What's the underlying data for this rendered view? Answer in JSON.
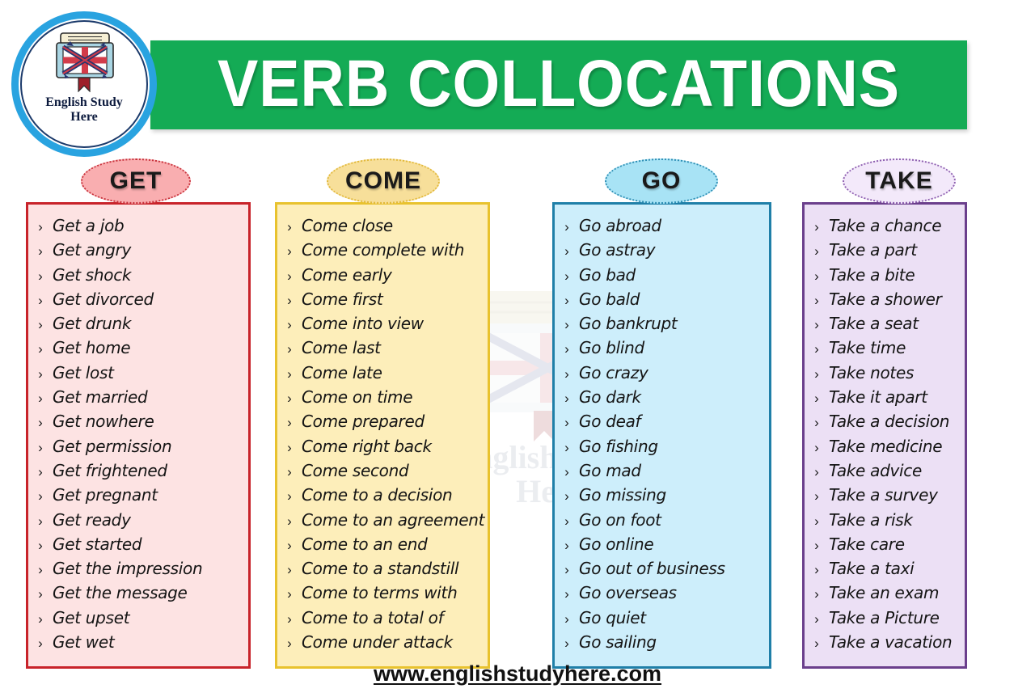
{
  "logo": {
    "name_line1": "English Study",
    "name_line2": "Here",
    "ring_color": "#29a3e0",
    "icon": "book-uk-flag-icon"
  },
  "header": {
    "title": "VERB COLLOCATIONS",
    "banner_color": "#14ab55",
    "title_color": "#ffffff"
  },
  "watermark": {
    "line1": "English Study",
    "line2": "Here"
  },
  "columns": [
    {
      "id": "get",
      "heading": "GET",
      "pill_fill": "#f9aeb0",
      "pill_border": "#c8323c",
      "box_fill": "#fde3e3",
      "box_border": "#c8232a",
      "items": [
        "Get a job",
        "Get angry",
        "Get shock",
        "Get divorced",
        "Get drunk",
        "Get home",
        "Get lost",
        "Get married",
        "Get nowhere",
        "Get permission",
        "Get frightened",
        "Get pregnant",
        "Get ready",
        "Get started",
        "Get the impression",
        "Get the message",
        "Get upset",
        "Get wet"
      ]
    },
    {
      "id": "come",
      "heading": "COME",
      "pill_fill": "#f7df9a",
      "pill_border": "#e2b93c",
      "box_fill": "#fdeeba",
      "box_border": "#e8c22e",
      "items": [
        "Come close",
        "Come complete with",
        "Come early",
        "Come first",
        "Come into view",
        "Come last",
        "Come late",
        "Come on time",
        "Come prepared",
        "Come right back",
        "Come second",
        "Come to a decision",
        "Come to an agreement",
        "Come to an end",
        "Come to a standstill",
        "Come to terms with",
        "Come to a total of",
        "Come under attack"
      ]
    },
    {
      "id": "go",
      "heading": "GO",
      "pill_fill": "#a8e3f5",
      "pill_border": "#2f8fb5",
      "box_fill": "#cdeefb",
      "box_border": "#1f7fa8",
      "items": [
        "Go abroad",
        "Go astray",
        "Go bad",
        "Go bald",
        "Go bankrupt",
        "Go blind",
        "Go crazy",
        "Go dark",
        "Go deaf",
        "Go fishing",
        "Go mad",
        "Go missing",
        "Go on foot",
        "Go online",
        "Go out of business",
        "Go overseas",
        "Go quiet",
        "Go sailing"
      ]
    },
    {
      "id": "take",
      "heading": "TAKE",
      "pill_fill": "#f3e9fa",
      "pill_border": "#8e5fb0",
      "box_fill": "#ece0f5",
      "box_border": "#6b3f8c",
      "items": [
        "Take a chance",
        "Take a part",
        "Take a bite",
        "Take a shower",
        "Take a seat",
        "Take time",
        "Take notes",
        "Take it apart",
        "Take a decision",
        "Take medicine",
        "Take advice",
        "Take a survey",
        "Take a risk",
        "Take care",
        "Take a taxi",
        "Take an exam",
        "Take a Picture",
        "Take a vacation"
      ]
    }
  ],
  "bullet_glyph": "›",
  "footer": {
    "url": "www.englishstudyhere.com"
  }
}
